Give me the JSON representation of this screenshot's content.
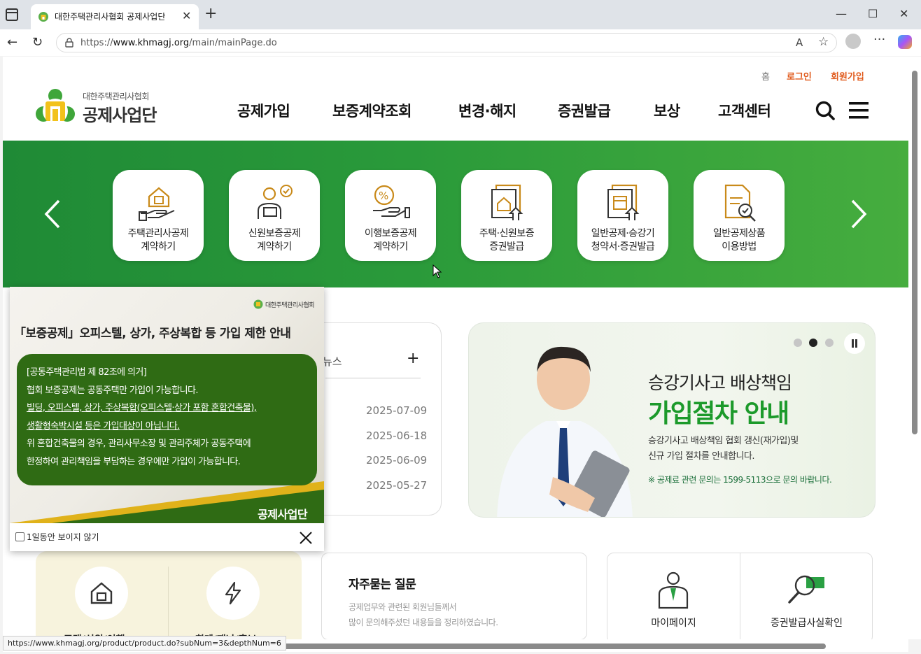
{
  "browser": {
    "tab_title": "대한주택관리사협회 공제사업단",
    "url_prefix": "https://",
    "url_domain": "www.khmagj.org",
    "url_path": "/main/mainPage.do",
    "status_url": "https://www.khmagj.org/product/product.do?subNum=3&depthNum=6"
  },
  "header": {
    "util": {
      "home": "홈",
      "login": "로그인",
      "join": "회원가입"
    },
    "logo": {
      "small": "대한주택관리사협회",
      "big": "공제사업단"
    },
    "gnb": [
      "공제가입",
      "보증계약조회",
      "변경·해지",
      "증권발급",
      "보상",
      "고객센터"
    ]
  },
  "quick_menu": [
    {
      "label": "주택관리사공제\n계약하기",
      "icon": "house-hand-icon"
    },
    {
      "label": "신원보증공제\n계약하기",
      "icon": "person-laptop-icon"
    },
    {
      "label": "이행보증공제\n계약하기",
      "icon": "percent-hand-icon"
    },
    {
      "label": "주택·신원보증\n증권발급",
      "icon": "document-house-icon"
    },
    {
      "label": "일반공제·승강기\n청약서·증권발급",
      "icon": "document-upload-icon"
    },
    {
      "label": "일반공제상품\n이용방법",
      "icon": "document-search-icon"
    }
  ],
  "news": {
    "tab": "뉴스",
    "plus": "+",
    "dates": [
      "2025-07-09",
      "2025-06-18",
      "2025-06-09",
      "2025-05-27"
    ]
  },
  "promo": {
    "title1": "승강기사고 배상책임",
    "title2": "가입절차 안내",
    "desc1": "승강기사고 배상책임 협회 갱신(재가입)및",
    "desc2": "신규 가입 절차를 안내합니다.",
    "note": "※ 공제료 관련 문의는 1599-5113으로 문의 바랍니다.",
    "active_slide": 2,
    "slide_count": 3
  },
  "quick2": {
    "labels": [
      "주택/신원/이행",
      "회계/재난/홍보"
    ]
  },
  "faq": {
    "title": "자주묻는 질문",
    "desc1": "공제업무와 관련된 회원님들께서",
    "desc2": "많이 문의해주셨던 내용들을 정리하였습니다."
  },
  "links": {
    "mypage": "마이페이지",
    "verify": "증권발급사실확인"
  },
  "popup": {
    "logo_text": "대한주택관리사협회",
    "title": "「보증공제」오피스텔, 상가, 주상복합 등 가입 제한 안내",
    "lines": [
      "[공동주택관리법 제 82조에 의거]",
      "협회 보증공제는 공동주택만 가입이 가능합니다.",
      "빌딩, 오피스텔, 상가, 주상복합(오피스텔·상가 포함 혼합건축물),",
      "생활형숙박시설 등은 가입대상이 아닙니다.",
      "위 혼합건축물의 경우, 관리사무소장 및 관리주체가 공동주택에",
      "한정하여 관리책임을 부담하는 경우에만 가입이 가능합니다."
    ],
    "brand": "공제사업단",
    "checkbox_label": "1일동안 보이지 않기"
  },
  "colors": {
    "green": "#2a9a3a",
    "accent_orange": "#e05a1c",
    "icon_gold": "#c98a1a"
  }
}
